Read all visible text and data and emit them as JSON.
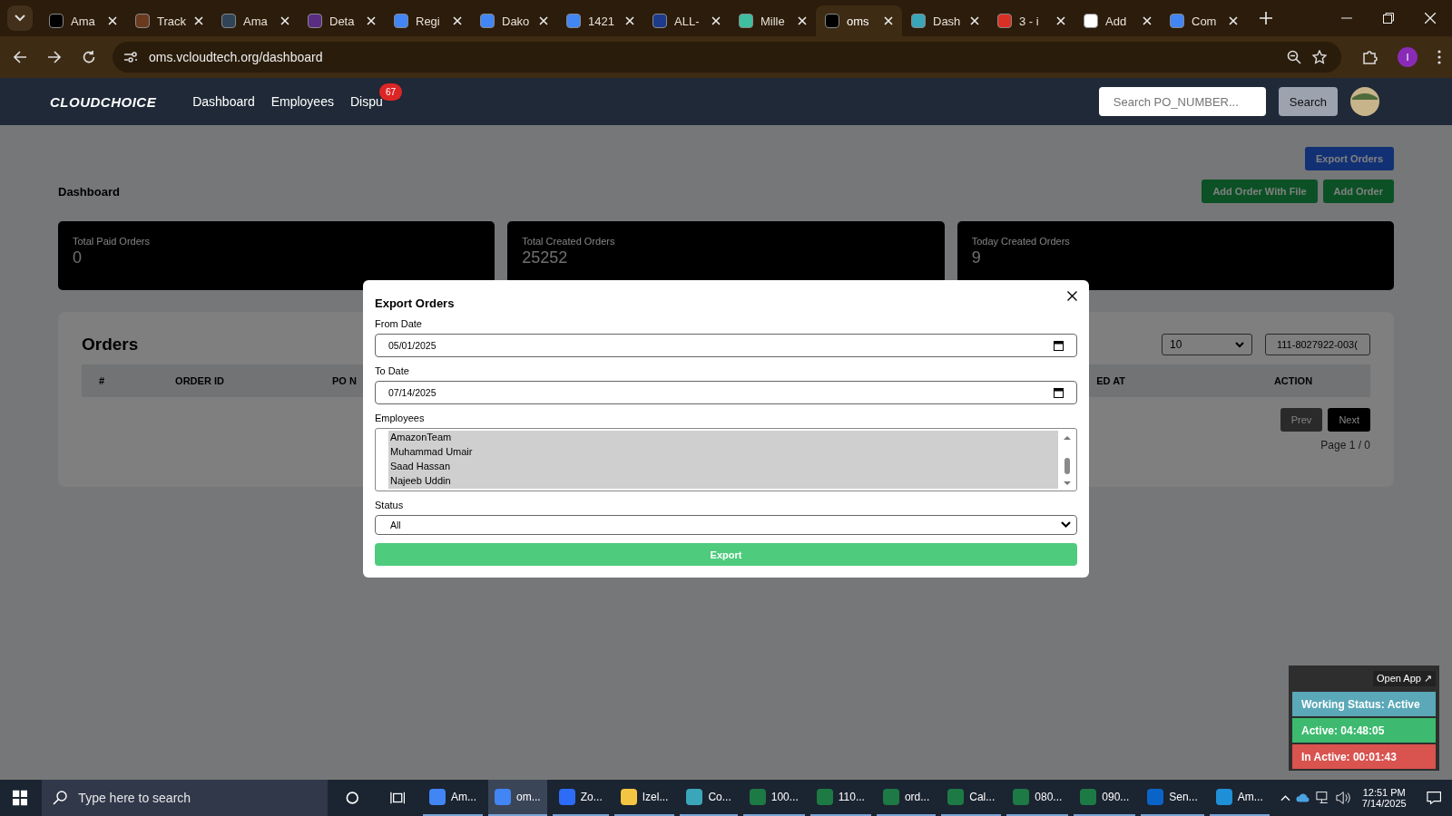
{
  "browser": {
    "tabs": [
      {
        "label": "Ama",
        "color": "#000000",
        "selected": false
      },
      {
        "label": "Track",
        "color": "#6b3a1e",
        "selected": false
      },
      {
        "label": "Ama",
        "color": "#2f4456",
        "selected": false
      },
      {
        "label": "Deta",
        "color": "#5a2d82",
        "selected": false
      },
      {
        "label": "Regi",
        "color": "#4285f4",
        "selected": false
      },
      {
        "label": "Dako",
        "color": "#4285f4",
        "selected": false
      },
      {
        "label": "1421",
        "color": "#4285f4",
        "selected": false
      },
      {
        "label": "ALL-",
        "color": "#1e3a8a",
        "selected": false
      },
      {
        "label": "Mille",
        "color": "#3fbf9f",
        "selected": false
      },
      {
        "label": "oms",
        "color": "#000000",
        "selected": true
      },
      {
        "label": "Dash",
        "color": "#3aa6b9",
        "selected": false
      },
      {
        "label": "3 - i",
        "color": "#d93025",
        "selected": false
      },
      {
        "label": "Add",
        "color": "#ffffff",
        "selected": false
      },
      {
        "label": "Com",
        "color": "#4285f4",
        "selected": false
      }
    ],
    "url": "oms.vcloudtech.org/dashboard",
    "profile_initial": "I"
  },
  "navbar": {
    "logo": "CLOUDCHOICE",
    "links": [
      {
        "label": "Dashboard"
      },
      {
        "label": "Employees"
      },
      {
        "label": "Dispu",
        "badge": "67"
      }
    ],
    "search": {
      "placeholder": "Search PO_NUMBER..."
    },
    "search_button": "Search"
  },
  "page": {
    "export_button": "Export Orders",
    "title": "Dashboard",
    "buttons": [
      "Add Order With File",
      "Add Order"
    ],
    "stats": [
      {
        "label": "Total Paid Orders",
        "value": "0"
      },
      {
        "label": "Total Created Orders",
        "value": "25252"
      },
      {
        "label": "Today Created Orders",
        "value": "9"
      }
    ],
    "orders": {
      "title": "Orders",
      "page_size": "10",
      "filter_value": "111-8027922-003(",
      "columns": [
        "#",
        "ORDER ID",
        "PO N",
        "ED AT",
        "ACTION"
      ],
      "prev": "Prev",
      "next": "Next",
      "page_info": "Page 1 / 0"
    }
  },
  "modal": {
    "title": "Export Orders",
    "from_label": "From Date",
    "from_value": "05/01/2025",
    "to_label": "To Date",
    "to_value": "07/14/2025",
    "employees_label": "Employees",
    "employees": [
      {
        "name": "AmazonTeam",
        "selected": true
      },
      {
        "name": "Muhammad Umair",
        "selected": true
      },
      {
        "name": "Saad Hassan",
        "selected": true
      },
      {
        "name": "Najeeb Uddin",
        "selected": true
      }
    ],
    "status_label": "Status",
    "status_value": "All",
    "export_button": "Export"
  },
  "widget": {
    "open_app": "Open App ↗",
    "rows": [
      {
        "text": "Working Status: Active",
        "color": "#5aa8b8"
      },
      {
        "text": "Active: 04:48:05",
        "color": "#3dba6f"
      },
      {
        "text": "In Active: 00:01:43",
        "color": "#d9534f"
      }
    ]
  },
  "taskbar": {
    "search_placeholder": "Type here to search",
    "apps": [
      {
        "label": "Am...",
        "color": "#4285f4",
        "selected": false
      },
      {
        "label": "om...",
        "color": "#4285f4",
        "selected": true
      },
      {
        "label": "Zo...",
        "color": "#2d6cf6",
        "selected": false
      },
      {
        "label": "Izel...",
        "color": "#f4c542",
        "selected": false
      },
      {
        "label": "Co...",
        "color": "#3aa6b9",
        "selected": false
      },
      {
        "label": "100...",
        "color": "#1d7a45",
        "selected": false
      },
      {
        "label": "110...",
        "color": "#1d7a45",
        "selected": false
      },
      {
        "label": "ord...",
        "color": "#1d7a45",
        "selected": false
      },
      {
        "label": "Cal...",
        "color": "#1d7a45",
        "selected": false
      },
      {
        "label": "080...",
        "color": "#1d7a45",
        "selected": false
      },
      {
        "label": "090...",
        "color": "#1d7a45",
        "selected": false
      },
      {
        "label": "Sen...",
        "color": "#0a64c8",
        "selected": false
      },
      {
        "label": "Am...",
        "color": "#1f8fd8",
        "selected": false
      }
    ],
    "time": "12:51 PM",
    "date": "7/14/2025"
  }
}
